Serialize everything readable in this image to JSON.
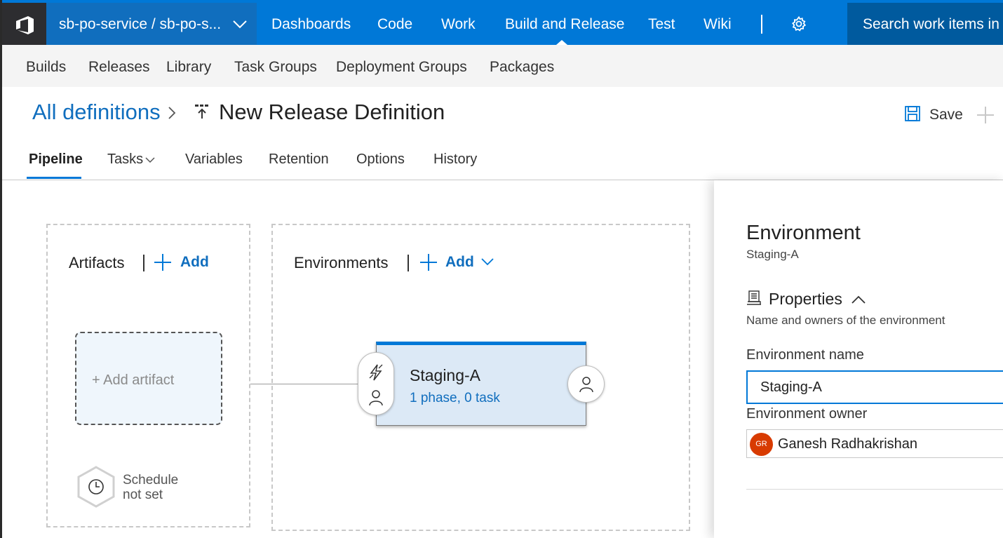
{
  "topbar": {
    "project": "sb-po-service / sb-po-s...",
    "nav": [
      "Dashboards",
      "Code",
      "Work",
      "Build and Release",
      "Test",
      "Wiki"
    ],
    "active_nav": "Build and Release",
    "search_placeholder": "Search work items in t",
    "colors": {
      "bar": "#0078d7",
      "logo_bg": "#2d2d30",
      "project_bg": "#106ebe",
      "search_bg": "#005a9e"
    }
  },
  "subnav": [
    "Builds",
    "Releases",
    "Library",
    "Task Groups",
    "Deployment Groups",
    "Packages"
  ],
  "header": {
    "breadcrumb_link": "All definitions",
    "title": "New Release Definition",
    "save_label": "Save"
  },
  "tabs": [
    "Pipeline",
    "Tasks",
    "Variables",
    "Retention",
    "Options",
    "History"
  ],
  "active_tab": "Pipeline",
  "artifacts": {
    "title": "Artifacts",
    "add_label": "Add",
    "card_label": "+ Add artifact",
    "schedule_line1": "Schedule",
    "schedule_line2": "not set"
  },
  "environments": {
    "title": "Environments",
    "add_label": "Add",
    "card": {
      "name": "Staging-A",
      "summary": "1 phase, 0 task"
    }
  },
  "panel": {
    "title": "Environment",
    "subtitle": "Staging-A",
    "section_title": "Properties",
    "section_desc": "Name and owners of the environment",
    "name_label": "Environment name",
    "name_value": "Staging-A",
    "owner_label": "Environment owner",
    "owner_initials": "GR",
    "owner_name": "Ganesh Radhakrishan"
  }
}
